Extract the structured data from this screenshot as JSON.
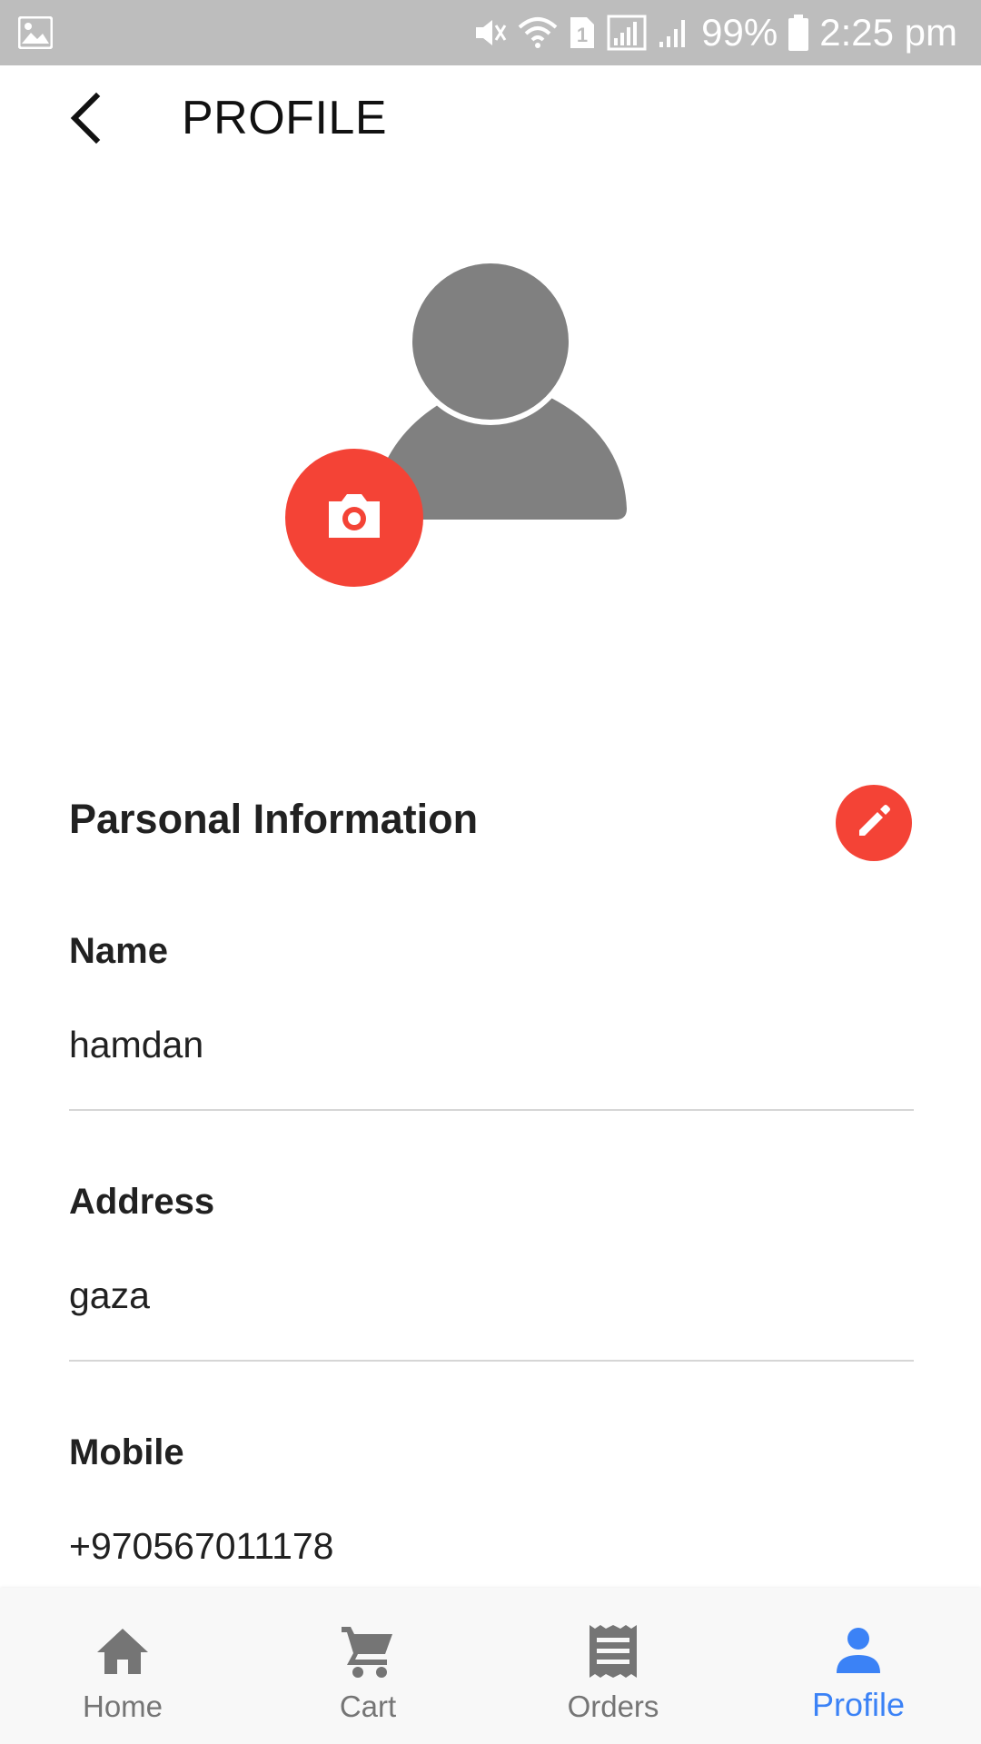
{
  "status_bar": {
    "battery_level": "99%",
    "time": "2:25 pm",
    "sim_slot": "1",
    "icons": [
      "gallery-icon",
      "mute-icon",
      "wifi-icon",
      "sim-icon",
      "signal-icon",
      "signal-icon",
      "battery-icon"
    ]
  },
  "header": {
    "title": "PROFILE",
    "back_icon": "back-arrow-icon"
  },
  "avatar": {
    "icon": "person-placeholder-icon",
    "camera_icon": "camera-icon"
  },
  "personal_info": {
    "title": "Parsonal Information",
    "edit_icon": "pencil-icon",
    "fields": [
      {
        "label": "Name",
        "value": "hamdan"
      },
      {
        "label": "Address",
        "value": "gaza"
      },
      {
        "label": "Mobile",
        "value": "+970567011178"
      }
    ]
  },
  "bottom_nav": {
    "items": [
      {
        "label": "Home",
        "icon": "home-icon",
        "active": false
      },
      {
        "label": "Cart",
        "icon": "cart-icon",
        "active": false
      },
      {
        "label": "Orders",
        "icon": "receipt-icon",
        "active": false
      },
      {
        "label": "Profile",
        "icon": "person-icon",
        "active": true
      }
    ]
  },
  "colors": {
    "accent": "#f44336",
    "active_tab": "#3b82f6",
    "status_bar": "#bdbdbd",
    "avatar": "#808080"
  }
}
